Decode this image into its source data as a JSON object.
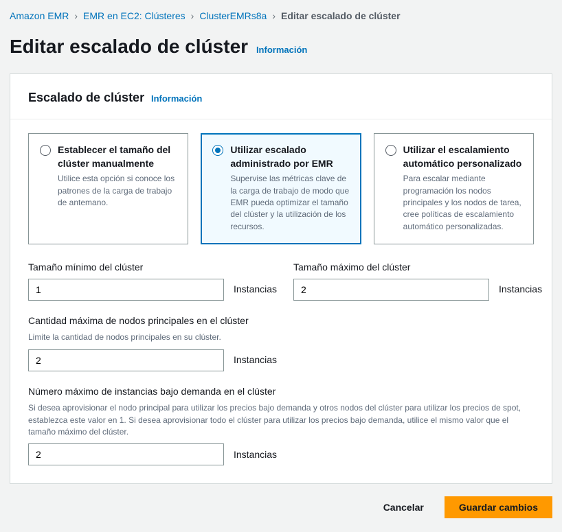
{
  "breadcrumb": {
    "items": [
      "Amazon EMR",
      "EMR en EC2: Clústeres",
      "ClusterEMRs8a"
    ],
    "current": "Editar escalado de clúster"
  },
  "page_title": "Editar escalado de clúster",
  "info_label": "Información",
  "panel": {
    "title": "Escalado de clúster",
    "info": "Información"
  },
  "options": {
    "manual": {
      "title": "Establecer el tamaño del clúster manualmente",
      "desc": "Utilice esta opción si conoce los patrones de la carga de trabajo de antemano."
    },
    "managed": {
      "title": "Utilizar escalado administrado por EMR",
      "desc": "Supervise las métricas clave de la carga de trabajo de modo que EMR pueda optimizar el tamaño del clúster y la utilización de los recursos."
    },
    "custom": {
      "title": "Utilizar el escalamiento automático personalizado",
      "desc": "Para escalar mediante programación los nodos principales y los nodos de tarea, cree políticas de escalamiento automático personalizadas."
    }
  },
  "fields": {
    "min_label": "Tamaño mínimo del clúster",
    "min_value": "1",
    "max_label": "Tamaño máximo del clúster",
    "max_value": "2",
    "core_label": "Cantidad máxima de nodos principales en el clúster",
    "core_help": "Limite la cantidad de nodos principales en su clúster.",
    "core_value": "2",
    "ondemand_label": "Número máximo de instancias bajo demanda en el clúster",
    "ondemand_help": "Si desea aprovisionar el nodo principal para utilizar los precios bajo demanda y otros nodos del clúster para utilizar los precios de spot, establezca este valor en 1. Si desea aprovisionar todo el clúster para utilizar los precios bajo demanda, utilice el mismo valor que el tamaño máximo del clúster.",
    "ondemand_value": "2",
    "unit": "Instancias"
  },
  "actions": {
    "cancel": "Cancelar",
    "save": "Guardar cambios"
  }
}
